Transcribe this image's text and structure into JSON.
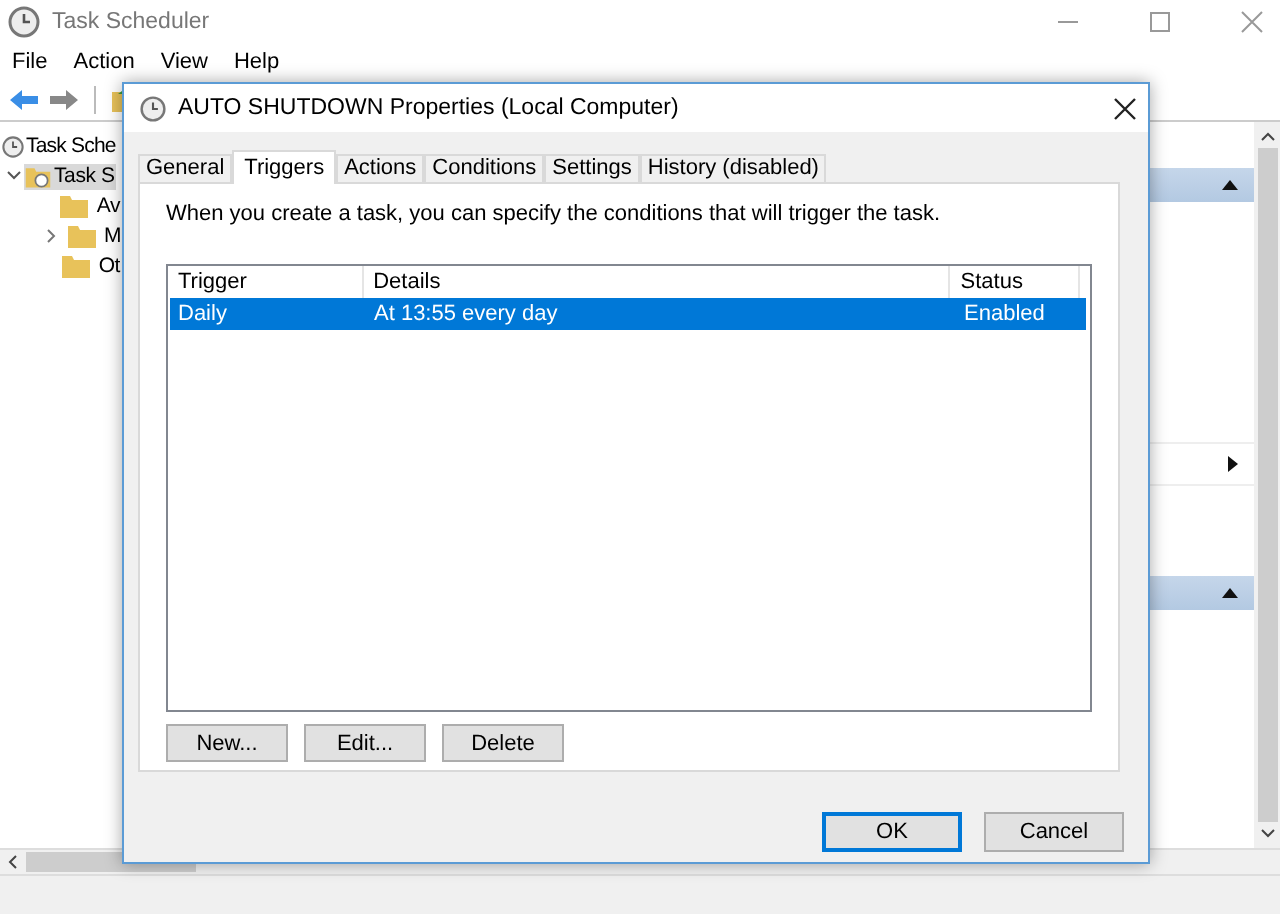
{
  "window": {
    "title": "Task Scheduler"
  },
  "menu": [
    "File",
    "Action",
    "View",
    "Help"
  ],
  "tree": [
    {
      "label": "Task Sche",
      "children": [
        {
          "label": "Task S",
          "expanded": true,
          "selected": true,
          "children": [
            {
              "label": "Av",
              "selected": false
            },
            {
              "label": "M",
              "expanded": false,
              "selected": false
            },
            {
              "label": "Ot",
              "selected": false
            }
          ]
        }
      ]
    }
  ],
  "dialog": {
    "title": "AUTO SHUTDOWN Properties (Local Computer)",
    "tabs": [
      {
        "label": "General",
        "selected": false
      },
      {
        "label": "Triggers",
        "selected": true
      },
      {
        "label": "Actions",
        "selected": false
      },
      {
        "label": "Conditions",
        "selected": false
      },
      {
        "label": "Settings",
        "selected": false
      },
      {
        "label": "History (disabled)",
        "selected": false
      }
    ],
    "description": "When you create a task, you can specify the conditions that will trigger the task.",
    "table": {
      "columns": [
        "Trigger",
        "Details",
        "Status"
      ],
      "rows": [
        {
          "cells": [
            "Daily",
            "At 13:55 every day",
            "Enabled"
          ],
          "selected": true
        }
      ]
    },
    "table_buttons": [
      "New...",
      "Edit...",
      "Delete"
    ],
    "buttons": [
      {
        "label": "OK",
        "default": true
      },
      {
        "label": "Cancel",
        "default": false
      }
    ]
  }
}
